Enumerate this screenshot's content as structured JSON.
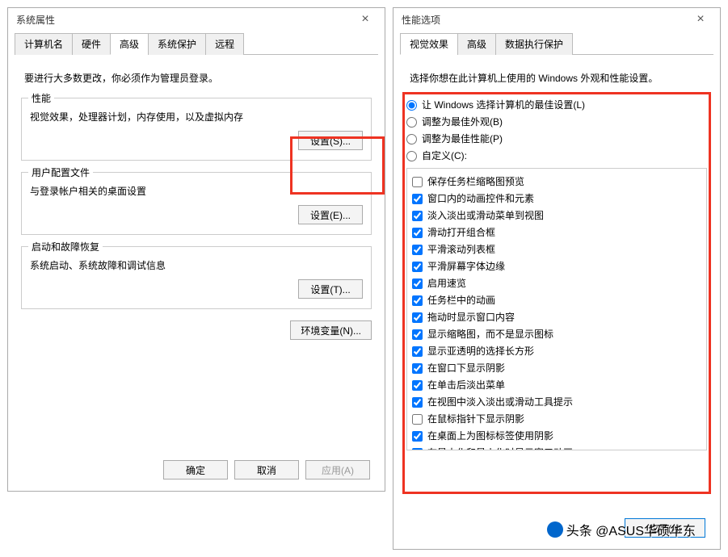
{
  "dlg1": {
    "title": "系统属性",
    "tabs": [
      "计算机名",
      "硬件",
      "高级",
      "系统保护",
      "远程"
    ],
    "activeTab": 2,
    "note": "要进行大多数更改，你必须作为管理员登录。",
    "groups": [
      {
        "title": "性能",
        "desc": "视觉效果，处理器计划，内存使用，以及虚拟内存",
        "btn": "设置(S)..."
      },
      {
        "title": "用户配置文件",
        "desc": "与登录帐户相关的桌面设置",
        "btn": "设置(E)..."
      },
      {
        "title": "启动和故障恢复",
        "desc": "系统启动、系统故障和调试信息",
        "btn": "设置(T)..."
      }
    ],
    "envbtn": "环境变量(N)...",
    "ok": "确定",
    "cancel": "取消",
    "apply": "应用(A)"
  },
  "dlg2": {
    "title": "性能选项",
    "tabs": [
      "视觉效果",
      "高级",
      "数据执行保护"
    ],
    "activeTab": 0,
    "note": "选择你想在此计算机上使用的 Windows 外观和性能设置。",
    "radios": [
      {
        "label": "让 Windows 选择计算机的最佳设置(L)",
        "checked": true
      },
      {
        "label": "调整为最佳外观(B)",
        "checked": false
      },
      {
        "label": "调整为最佳性能(P)",
        "checked": false
      },
      {
        "label": "自定义(C):",
        "checked": false
      }
    ],
    "checks": [
      {
        "label": "保存任务栏缩略图预览",
        "checked": false
      },
      {
        "label": "窗口内的动画控件和元素",
        "checked": true
      },
      {
        "label": "淡入淡出或滑动菜单到视图",
        "checked": true
      },
      {
        "label": "滑动打开组合框",
        "checked": true
      },
      {
        "label": "平滑滚动列表框",
        "checked": true
      },
      {
        "label": "平滑屏幕字体边缘",
        "checked": true
      },
      {
        "label": "启用速览",
        "checked": true
      },
      {
        "label": "任务栏中的动画",
        "checked": true
      },
      {
        "label": "拖动时显示窗口内容",
        "checked": true
      },
      {
        "label": "显示缩略图，而不是显示图标",
        "checked": true
      },
      {
        "label": "显示亚透明的选择长方形",
        "checked": true
      },
      {
        "label": "在窗口下显示阴影",
        "checked": true
      },
      {
        "label": "在单击后淡出菜单",
        "checked": true
      },
      {
        "label": "在视图中淡入淡出或滑动工具提示",
        "checked": true
      },
      {
        "label": "在鼠标指针下显示阴影",
        "checked": false
      },
      {
        "label": "在桌面上为图标标签使用阴影",
        "checked": true
      },
      {
        "label": "在最大化和最小化时显示窗口动画",
        "checked": true
      }
    ],
    "applyBtn": "应用(A)"
  },
  "watermark": "头条 @ASUS华硕华东"
}
